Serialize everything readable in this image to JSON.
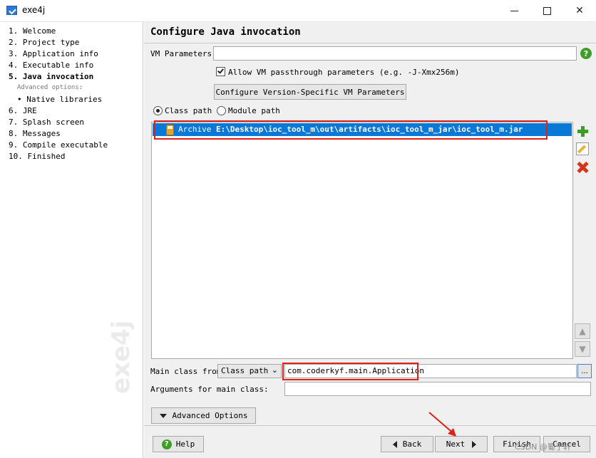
{
  "window": {
    "title": "exe4j"
  },
  "sidebar": {
    "steps": [
      {
        "label": "1. Welcome"
      },
      {
        "label": "2. Project type"
      },
      {
        "label": "3. Application info"
      },
      {
        "label": "4. Executable info"
      },
      {
        "label": "5. Java invocation",
        "active": true
      },
      {
        "label": "6. JRE"
      },
      {
        "label": "7. Splash screen"
      },
      {
        "label": "8. Messages"
      },
      {
        "label": "9. Compile executable"
      },
      {
        "label": "10. Finished"
      }
    ],
    "advanced_label": "Advanced options:",
    "native_libraries": "Native libraries",
    "watermark": "exe4j"
  },
  "main": {
    "title": "Configure Java invocation",
    "vm_parameters_label": "VM Parameters:",
    "vm_parameters_value": "",
    "allow_passthrough_label": "Allow VM passthrough parameters (e.g. -J-Xmx256m)",
    "allow_passthrough_checked": true,
    "configure_version_button": "Configure Version-Specific VM Parameters",
    "class_path_radio": "Class path",
    "module_path_radio": "Module path",
    "classpath_entries": [
      {
        "type": "Archive",
        "path": "E:\\Desktop\\ioc_tool_m\\out\\artifacts\\ioc_tool_m_jar\\ioc_tool_m.jar"
      }
    ],
    "main_class_from_label": "Main class from",
    "main_class_source": "Class path",
    "main_class_value": "com.coderkyf.main.Application",
    "dots_label": "...",
    "arguments_label": "Arguments for main class:",
    "arguments_value": "",
    "advanced_options_button": "Advanced Options"
  },
  "footer": {
    "help": "Help",
    "back": "Back",
    "next": "Next",
    "finish": "Finish",
    "cancel": "Cancel",
    "credit": "CSDN @蜀于轩"
  },
  "colors": {
    "selection": "#0a78d7",
    "highlight_box": "#e0201a",
    "help_green": "#3f9e2a"
  }
}
